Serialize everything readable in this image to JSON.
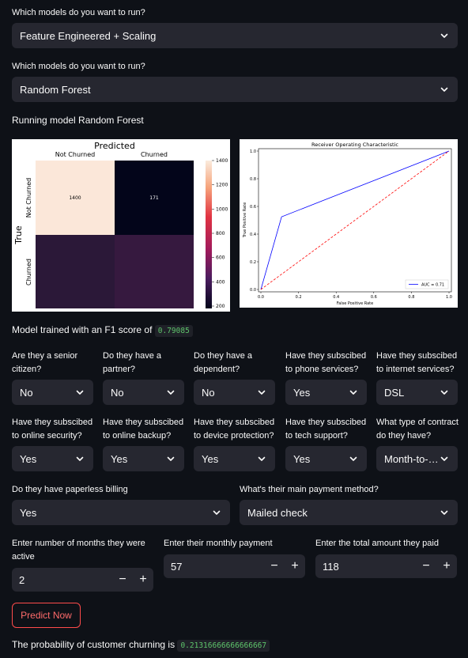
{
  "models_select_1": {
    "label": "Which models do you want to run?",
    "value": "Feature Engineered + Scaling"
  },
  "models_select_2": {
    "label": "Which models do you want to run?",
    "value": "Random Forest"
  },
  "running_text": "Running model Random Forest",
  "confusion_matrix": {
    "title": "Predicted",
    "col_labels": [
      "Not Churned",
      "Churned"
    ],
    "row_labels": [
      "Not Churned",
      "Churned"
    ],
    "ylabel": "True",
    "cell_values": [
      "1400",
      "171",
      "",
      ""
    ],
    "cell_colors": [
      "#fbe7d9",
      "#03051a",
      "#2b1838",
      "#36193f"
    ],
    "colorbar_ticks": [
      "1400",
      "1200",
      "1000",
      "800",
      "600",
      "400",
      "200"
    ]
  },
  "chart_data": {
    "type": "line",
    "title": "Receiver Operating Characteristic",
    "xlabel": "False Positive Rate",
    "ylabel": "True Positive Rate",
    "xlim": [
      0,
      1
    ],
    "ylim": [
      0,
      1
    ],
    "xticks": [
      "0.0",
      "0.2",
      "0.4",
      "0.6",
      "0.8",
      "1.0"
    ],
    "yticks": [
      "0.0",
      "0.2",
      "0.4",
      "0.6",
      "0.8",
      "1.0"
    ],
    "series": [
      {
        "name": "AUC = 0.71",
        "color": "#0000ff",
        "style": "solid",
        "x": [
          0,
          0.11,
          1
        ],
        "y": [
          0,
          0.525,
          1
        ]
      },
      {
        "color": "#ff0000",
        "style": "dashed",
        "x": [
          0,
          1
        ],
        "y": [
          0,
          1
        ]
      }
    ],
    "legend_placement": "lower-right"
  },
  "f1": {
    "text": "Model trained with an F1 score of",
    "value": "0.79085"
  },
  "fields_row1": [
    {
      "label": "Are they a senior citizen?",
      "value": "No"
    },
    {
      "label": "Do they have a partner?",
      "value": "No"
    },
    {
      "label": "Do they have a dependent?",
      "value": "No"
    },
    {
      "label": "Have they subscibed to phone services?",
      "value": "Yes"
    },
    {
      "label": "Have they subscibed to internet services?",
      "value": "DSL"
    }
  ],
  "fields_row2": [
    {
      "label": "Have they subscibed to online security?",
      "value": "Yes"
    },
    {
      "label": "Have they subscibed to online backup?",
      "value": "Yes"
    },
    {
      "label": "Have they subscibed to device protection?",
      "value": "Yes"
    },
    {
      "label": "Have they subscibed to tech support?",
      "value": "Yes"
    },
    {
      "label": "What type of contract do they have?",
      "value": "Month-to-month"
    }
  ],
  "paperless": {
    "label": "Do they have paperless billing",
    "value": "Yes"
  },
  "payment": {
    "label": "What's their main payment method?",
    "value": "Mailed check"
  },
  "months": {
    "label": "Enter number of months they were active",
    "value": "2"
  },
  "monthly": {
    "label": "Enter their monthly payment",
    "value": "57"
  },
  "total": {
    "label": "Enter the total amount they paid",
    "value": "118"
  },
  "stepper": {
    "minus": "−",
    "plus": "+"
  },
  "predict_button": "Predict Now",
  "result": {
    "text": "The probability of customer churning is",
    "value": "0.21316666666666667"
  }
}
